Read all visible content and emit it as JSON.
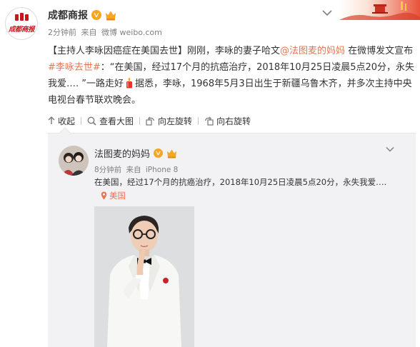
{
  "header": {
    "avatar_logo_text": "成都商报",
    "author": "成都商报",
    "meta": {
      "time": "2分钟前",
      "from_label": "来自",
      "source": "微博 weibo.com"
    }
  },
  "post": {
    "topic": "【主持人李咏因癌症在美国去世】",
    "part1": "刚刚，李咏的妻子哈文",
    "mention": "@法图麦的妈妈",
    "part2": " 在微博发文宣布",
    "hashtag": "#李咏去世#",
    "part3": "：“在美国，经过17个月的抗癌治疗，2018年10月25日凌晨5点20分，永失我爱…. ”一路走好",
    "part4": "据悉，李咏，1968年5月3日出生于新疆乌鲁木齐，并多次主持中央电视台春节联欢晚会。"
  },
  "actions": {
    "collapse": "收起",
    "view_large": "查看大图",
    "rotate_left": "向左旋转",
    "rotate_right": "向右旋转"
  },
  "repost": {
    "author": "法图麦的妈妈",
    "meta": {
      "time": "8分钟前",
      "from_label": "来自",
      "source": "iPhone 8"
    },
    "text": "在美国，经过17个月的抗癌治疗，2018年10月25日凌晨5点20分，永失我爱…. ",
    "location": "美国"
  },
  "colors": {
    "link": "#eb7350",
    "verified": "#f5a623",
    "card_bg": "#f2f2f5",
    "logo_red": "#c8161d"
  }
}
